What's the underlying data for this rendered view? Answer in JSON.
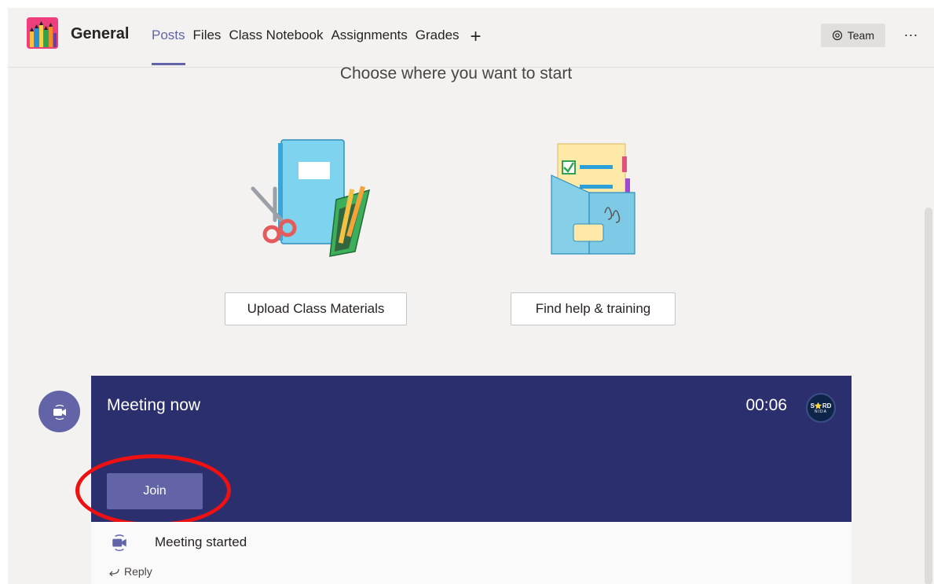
{
  "header": {
    "channel": "General",
    "tabs": [
      "Posts",
      "Files",
      "Class Notebook",
      "Assignments",
      "Grades"
    ],
    "active_tab": "Posts",
    "add_tab": "+",
    "team_button": "Team",
    "more": "..."
  },
  "main": {
    "choose_text": "Choose where you want to start",
    "upload_label": "Upload Class Materials",
    "help_label": "Find help & training"
  },
  "meeting": {
    "title": "Meeting now",
    "timer": "00:06",
    "organizer_badge": "S⭐RD",
    "organizer_badge_sub": "NIDA",
    "join_label": "Join",
    "started_text": "Meeting started",
    "reply_label": "Reply"
  },
  "icons": {
    "video": "video-camera-icon",
    "eye": "eye-icon",
    "reply": "reply-arrow-icon"
  },
  "colors": {
    "accent": "#6264a7",
    "meeting_card": "#2b2f6e",
    "highlight": "#ee1111"
  }
}
